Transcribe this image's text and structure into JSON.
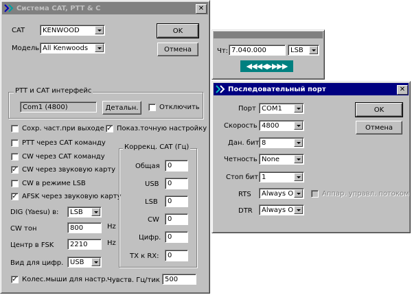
{
  "cat_window": {
    "title": "Система CAT, PTT & C",
    "cat_label": "CAT",
    "cat_value": "KENWOOD",
    "model_label": "Модель",
    "model_value": "All Kenwoods",
    "ok": "OK",
    "cancel": "Отмена",
    "ptt_group_title": "PTT и CAT интерфейс",
    "port_value": "Com1 (4800)",
    "details_button": "Детальн.",
    "disable_label": "Отключить",
    "checkboxes": [
      {
        "label": "Сохр. част.при выходе",
        "checked": false
      },
      {
        "label": "PTT через CAT команду",
        "checked": false
      },
      {
        "label": "CW через CAT команду",
        "checked": false
      },
      {
        "label": "CW через звуковую карту",
        "checked": true
      },
      {
        "label": "CW в режиме LSB",
        "checked": false
      },
      {
        "label": "AFSK через звуковую карту",
        "checked": true
      }
    ],
    "show_tuning": {
      "label": "Показ.точную настройку",
      "checked": true
    },
    "dig_label": "DIG (Yaesu) в:",
    "dig_value": "LSB",
    "cw_tone_label": "CW тон",
    "cw_tone_value": "800",
    "hz1": "Hz",
    "fsk_label": "Центр в FSK",
    "fsk_value": "2210",
    "hz2": "Hz",
    "digital_view_label": "Вид для цифр.",
    "digital_view_value": "USB",
    "mouse_wheel": {
      "label": "Колес.мыши для настр.",
      "checked": true
    },
    "sens_label": "Чувств. Гц/тик",
    "sens_value": "500",
    "corr_group_title": "Коррекц. CAT (Гц)",
    "corrections": [
      {
        "label": "Общая",
        "value": "0"
      },
      {
        "label": "USB",
        "value": "0"
      },
      {
        "label": "LSB",
        "value": "0"
      },
      {
        "label": "CW",
        "value": "0"
      },
      {
        "label": "Цифр.",
        "value": "0"
      },
      {
        "label": "TX к RX:",
        "value": "0"
      }
    ]
  },
  "freq_window": {
    "freq_label": "Чт:",
    "freq_value": "7.040.000",
    "mode_value": "LSB",
    "nav_arrows": "◀◀◀◀▶▶▶▶"
  },
  "serial_window": {
    "title": "Последовательный порт",
    "port_label": "Порт",
    "port_value": "COM1",
    "speed_label": "Скорость",
    "speed_value": "4800",
    "databits_label": "Дан. бит",
    "databits_value": "8",
    "parity_label": "Четность",
    "parity_value": "None",
    "stopbits_label": "Стоп бит",
    "stopbits_value": "1",
    "rts_label": "RTS",
    "rts_value": "Always On",
    "dtr_label": "DTR",
    "dtr_value": "Always On",
    "flow_label": "Аппар. управл. потоком",
    "ok": "OK",
    "cancel": "Отмена"
  }
}
